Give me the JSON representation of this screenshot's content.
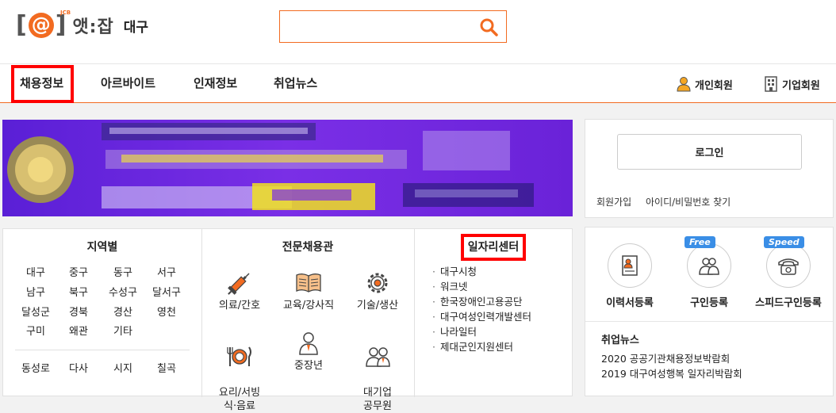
{
  "header": {
    "logo_bracket_open": "[",
    "logo_at": "@",
    "logo_bracket_close": "]",
    "logo_jcb": "JCB",
    "logo_name": "앳:잡",
    "region": "대구",
    "search_value": "",
    "accent_color": "#f26b21"
  },
  "nav": {
    "items": [
      {
        "label": "채용정보"
      },
      {
        "label": "아르바이트"
      },
      {
        "label": "인재정보"
      },
      {
        "label": "취업뉴스"
      }
    ],
    "personal_member": "개인회원",
    "company_member": "기업회원"
  },
  "login": {
    "button": "로그인",
    "signup": "회원가입",
    "find": "아이디/비밀번호 찾기"
  },
  "regions": {
    "title": "지역별",
    "items": [
      "대구",
      "중구",
      "동구",
      "서구",
      "남구",
      "북구",
      "수성구",
      "달서구",
      "달성군",
      "경북",
      "경산",
      "영천",
      "구미",
      "왜관",
      "기타"
    ],
    "extra": [
      "동성로",
      "다사",
      "시지",
      "칠곡"
    ]
  },
  "specialty": {
    "title": "전문채용관",
    "items": [
      {
        "label": "의료/간호",
        "icon": "syringe-icon"
      },
      {
        "label": "교육/강사직",
        "icon": "book-icon"
      },
      {
        "label": "기술/생산",
        "icon": "gear-icon"
      },
      {
        "label": "요리/서빙\n식·음료",
        "icon": "dining-icon"
      },
      {
        "label": "중장년",
        "icon": "person-icon"
      },
      {
        "label": "대기업\n공무원",
        "icon": "people-icon"
      }
    ]
  },
  "job_centers": {
    "title": "일자리센터",
    "items": [
      "대구시청",
      "워크넷",
      "한국장애인고용공단",
      "대구여성인력개발센터",
      "나라일터",
      "제대군인지원센터"
    ]
  },
  "registration": {
    "items": [
      {
        "label": "이력서등록",
        "tag": ""
      },
      {
        "label": "구인등록",
        "tag": "Free"
      },
      {
        "label": "스피드구인등록",
        "tag": "Speed"
      }
    ]
  },
  "news": {
    "title": "취업뉴스",
    "items": [
      "2020 공공기관채용정보박람회",
      "2019 대구여성행복 일자리박람회"
    ]
  }
}
